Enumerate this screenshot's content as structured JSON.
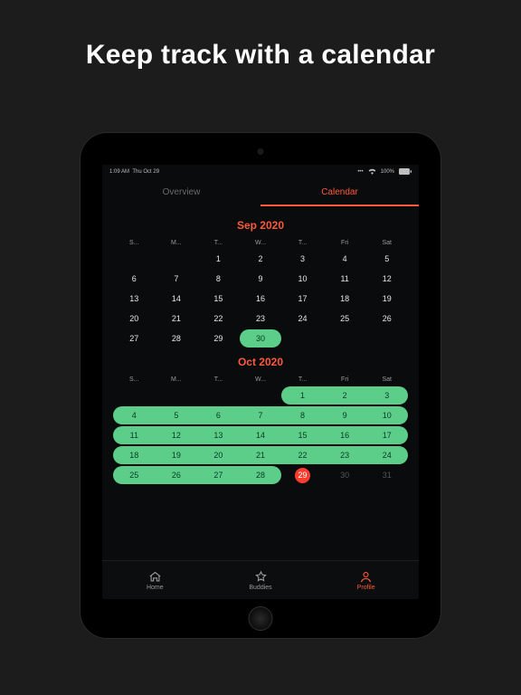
{
  "headline": "Keep track with a calendar",
  "status": {
    "time": "1:09 AM",
    "date": "Thu Oct 29",
    "signal": "100%"
  },
  "tabs": {
    "overview": "Overview",
    "calendar": "Calendar"
  },
  "months": {
    "sep": {
      "title": "Sep 2020",
      "weekdays": [
        "S...",
        "M...",
        "T...",
        "W...",
        "T...",
        "Fri",
        "Sat"
      ],
      "rows": [
        [
          "",
          "",
          "1",
          "2",
          "3",
          "4",
          "5"
        ],
        [
          "6",
          "7",
          "8",
          "9",
          "10",
          "11",
          "12"
        ],
        [
          "13",
          "14",
          "15",
          "16",
          "17",
          "18",
          "19"
        ],
        [
          "20",
          "21",
          "22",
          "23",
          "24",
          "25",
          "26"
        ],
        [
          "27",
          "28",
          "29",
          "30",
          "",
          "",
          ""
        ]
      ]
    },
    "oct": {
      "title": "Oct 2020",
      "weekdays": [
        "S...",
        "M...",
        "T...",
        "W...",
        "T...",
        "Fri",
        "Sat"
      ],
      "rows": [
        [
          "",
          "",
          "",
          "",
          "1",
          "2",
          "3"
        ],
        [
          "4",
          "5",
          "6",
          "7",
          "8",
          "9",
          "10"
        ],
        [
          "11",
          "12",
          "13",
          "14",
          "15",
          "16",
          "17"
        ],
        [
          "18",
          "19",
          "20",
          "21",
          "22",
          "23",
          "24"
        ],
        [
          "25",
          "26",
          "27",
          "28",
          "29",
          "30",
          "31"
        ]
      ]
    }
  },
  "nav": {
    "home": "Home",
    "buddies": "Buddies",
    "profile": "Profile"
  },
  "colors": {
    "accent": "#ff5a3c",
    "highlight": "#5cce8a"
  }
}
